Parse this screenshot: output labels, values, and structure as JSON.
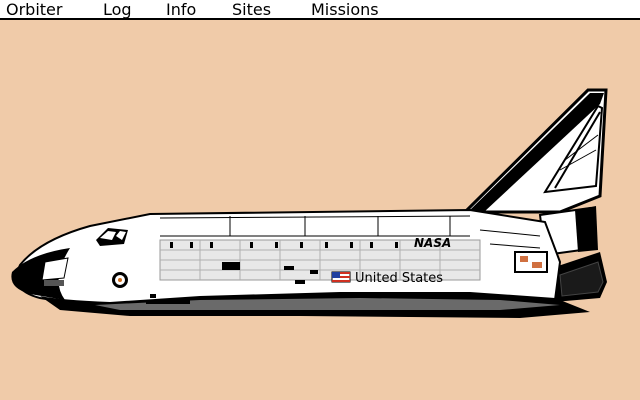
{
  "menubar": {
    "items": [
      {
        "label": "Orbiter"
      },
      {
        "label": "Log"
      },
      {
        "label": "Info"
      },
      {
        "label": "Sites"
      },
      {
        "label": "Missions"
      }
    ]
  },
  "orbiter": {
    "country_label": "United States",
    "agency_logo": "NASA"
  },
  "colors": {
    "background": "#f0cba9",
    "menubar": "#ffffff",
    "orbiter_body": "#ffffff",
    "thermal_tiles": "#000000",
    "flag_red": "#d03020",
    "flag_blue": "#2040a0"
  }
}
